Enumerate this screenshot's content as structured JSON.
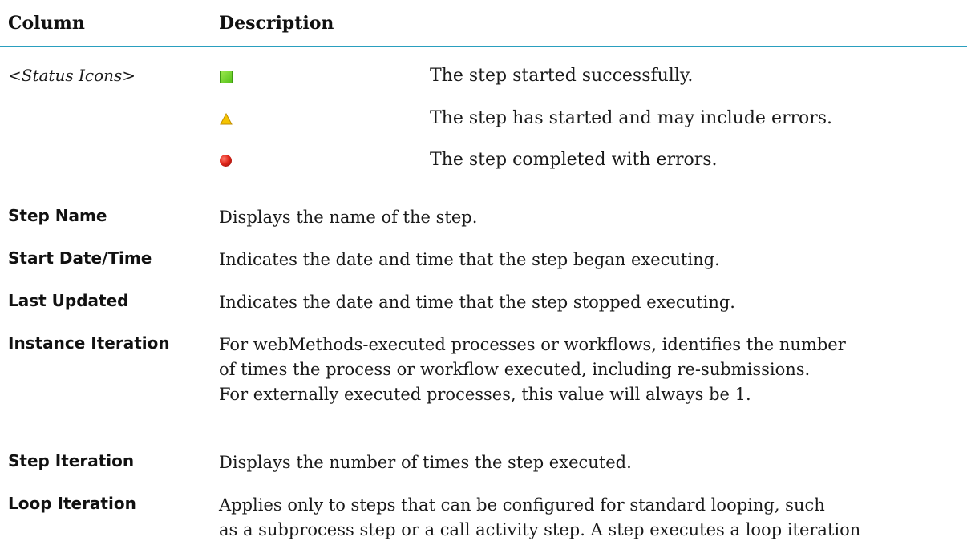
{
  "header": {
    "column_label": "Column",
    "description_label": "Description"
  },
  "status_section": {
    "label_prefix": "<",
    "label_text": "Status Icons",
    "label_suffix": ">",
    "items": [
      {
        "icon": "green-square-icon",
        "color": "#57c21b",
        "text": "The step started successfully."
      },
      {
        "icon": "yellow-triangle-icon",
        "color": "#f5c400",
        "text": "The step has started and may include errors."
      },
      {
        "icon": "red-ball-icon",
        "color": "#e0251a",
        "text": "The step completed with errors."
      }
    ]
  },
  "rows": [
    {
      "term": "Step Name",
      "desc_lines": [
        "Displays the name of the step."
      ]
    },
    {
      "term": "Start Date/Time",
      "desc_lines": [
        "Indicates the date and time that the step began executing."
      ]
    },
    {
      "term": "Last Updated",
      "desc_lines": [
        "Indicates the date and time that the step stopped executing."
      ]
    },
    {
      "term": "Instance Iteration",
      "desc_lines": [
        "For webMethods-executed processes or workflows, identifies the number",
        "of times the process or workflow executed, including re-submissions.",
        "For externally executed processes, this value will always be 1."
      ]
    },
    {
      "term": "Step Iteration",
      "desc_lines": [
        "Displays the number of times the step executed."
      ]
    },
    {
      "term": "Loop Iteration",
      "desc_lines": [
        "Applies only to steps that can be configured for standard looping, such",
        "as a subprocess step or a call activity step. A step executes a loop iteration"
      ]
    }
  ],
  "colors": {
    "header_rule": "#2a9fbf"
  }
}
